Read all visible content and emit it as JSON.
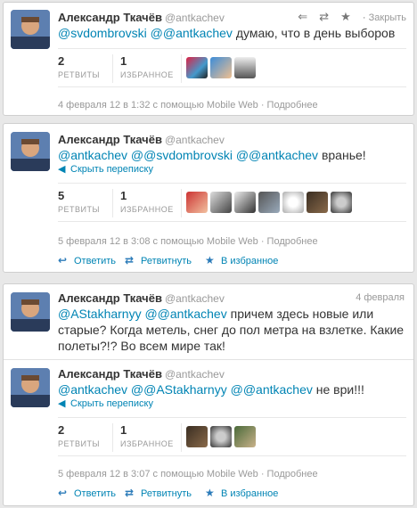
{
  "tweets": [
    {
      "author": "Александр Ткачёв",
      "handle": "@antkachev",
      "text_mentions": "@svdombrovski @@antkachev",
      "text_body": " думаю, что в день выборов",
      "retweets": "2",
      "retweets_label": "РЕТВИТЫ",
      "favorites": "1",
      "favorites_label": "ИЗБРАННОЕ",
      "meta": "4 февраля 12 в 1:32 с помощью Mobile Web · Подробнее",
      "top_actions": {
        "delete_label": "Закрыть"
      }
    },
    {
      "author": "Александр Ткачёв",
      "handle": "@antkachev",
      "text_mentions": "@antkachev @@svdombrovski @@antkachev",
      "text_body": " вранье!",
      "hide_conversation": "Скрыть переписку",
      "retweets": "5",
      "retweets_label": "РЕТВИТЫ",
      "favorites": "1",
      "favorites_label": "ИЗБРАННОЕ",
      "meta": "5 февраля 12 в 3:08 с помощью Mobile Web · Подробнее",
      "actions": {
        "reply": "Ответить",
        "retweet": "Ретвитнуть",
        "favorite": "В избранное"
      }
    },
    {
      "author": "Александр Ткачёв",
      "handle": "@antkachev",
      "date": "4 февраля",
      "text_mentions": "@AStakharnyy @@antkachev",
      "text_body": " причем здесь новые или старые? Когда метель, снег до пол метра на взлетке. Какие полеты?!? Во всем мире так!"
    },
    {
      "author": "Александр Ткачёв",
      "handle": "@antkachev",
      "text_mentions": "@antkachev @@AStakharnyy @@antkachev",
      "text_body": " не ври!!!",
      "hide_conversation": "Скрыть переписку",
      "retweets": "2",
      "retweets_label": "РЕТВИТЫ",
      "favorites": "1",
      "favorites_label": "ИЗБРАННОЕ",
      "meta": "5 февраля 12 в 3:07 с помощью Mobile Web · Подробнее",
      "actions": {
        "reply": "Ответить",
        "retweet": "Ретвитнуть",
        "favorite": "В избранное"
      }
    }
  ],
  "icons": {
    "reply": "reply-icon",
    "retweet": "retweet-icon",
    "favorite": "star-icon",
    "hide": "arrow-left-icon"
  }
}
